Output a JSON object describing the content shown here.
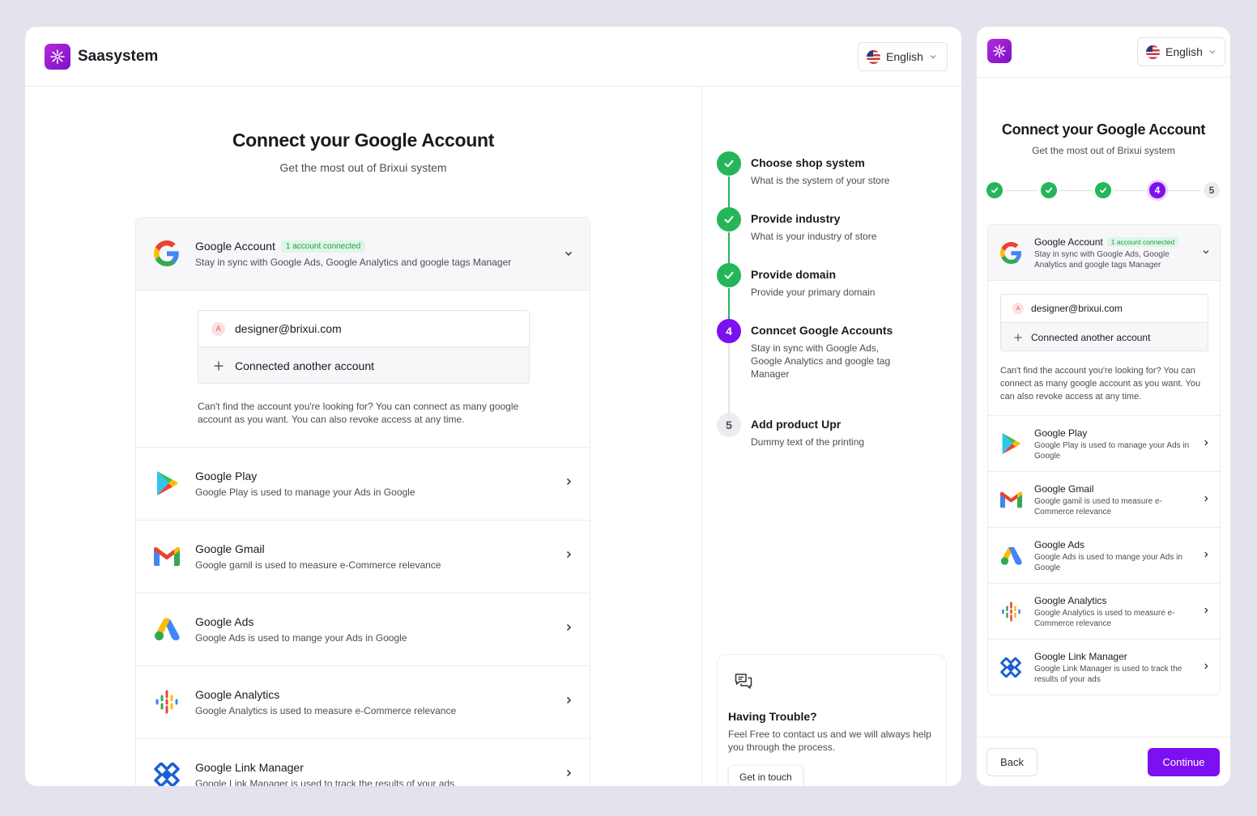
{
  "app": {
    "name": "Saasystem"
  },
  "language": {
    "selected": "English"
  },
  "page": {
    "title": "Connect your Google Account",
    "subtitle": "Get the most out of Brixui system"
  },
  "google_account": {
    "name": "Google Account",
    "badge": "1 account connected",
    "description": "Stay in sync with Google Ads, Google Analytics and google tags Manager",
    "account_initial": "A",
    "account_email": "designer@brixui.com",
    "add_account_label": "Connected another account",
    "helper_text": "Can't find the account you're looking for? You can connect as many google account as you want. You can also revoke access at any time."
  },
  "services": [
    {
      "name": "Google Play",
      "description": "Google Play is used to manage your Ads in Google",
      "icon": "google-play-icon"
    },
    {
      "name": "Google Gmail",
      "description": "Google gamil is used to measure e-Commerce relevance",
      "icon": "gmail-icon"
    },
    {
      "name": "Google Ads",
      "description": "Google Ads is used to mange your Ads in Google",
      "icon": "google-ads-icon"
    },
    {
      "name": "Google Analytics",
      "description": "Google Analytics is used to measure e-Commerce relevance",
      "icon": "google-analytics-icon"
    },
    {
      "name": "Google Link Manager",
      "description": "Google Link Manager is used to track the results of your ads",
      "icon": "link-manager-icon"
    }
  ],
  "steps": [
    {
      "number": "1",
      "title": "Choose shop system",
      "description": "What is the system of your store",
      "status": "done"
    },
    {
      "number": "2",
      "title": "Provide industry",
      "description": "What is your industry of store",
      "status": "done"
    },
    {
      "number": "3",
      "title": "Provide domain",
      "description": "Provide your primary domain",
      "status": "done"
    },
    {
      "number": "4",
      "title": "Conncet Google Accounts",
      "description": "Stay in sync with Google Ads, Google Analytics and google tag Manager",
      "status": "active"
    },
    {
      "number": "5",
      "title": "Add product Upr",
      "description": "Dummy text of the printing",
      "status": "todo"
    }
  ],
  "help": {
    "title": "Having Trouble?",
    "description": "Feel Free to contact us and we will always help you through the process.",
    "button": "Get in touch"
  },
  "footer": {
    "back": "Back",
    "continue": "Continue"
  },
  "colors": {
    "accent": "#7c10f0",
    "success": "#25b659",
    "badge_bg": "#dff6e6",
    "badge_text": "#1f9a4a"
  }
}
